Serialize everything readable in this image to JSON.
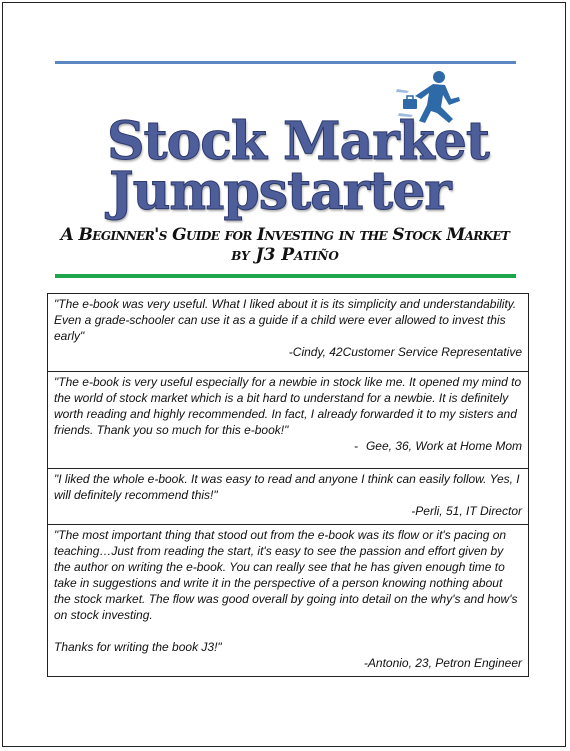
{
  "header": {
    "title_line1": "Stock Market",
    "title_line2": "Jumpstarter",
    "subtitle_line1": "A Beginner's Guide for Investing in the Stock Market",
    "subtitle_line2": "by J3 Patiño",
    "brand_color": "#4d5e9a",
    "rule_top_color": "#5a86c4",
    "rule_bottom_color": "#1fa64a",
    "logo_icon": "running-businessman-icon"
  },
  "testimonials": [
    {
      "quote": "\"The e-book was very useful.  What I liked about it is its simplicity and understandability.  Even a grade-schooler can use it as a guide if a child were ever allowed to invest this early\"",
      "author": "-Cindy, 42Customer Service Representative"
    },
    {
      "quote": "\"The e-book is very useful especially for a newbie in stock like me. It opened my mind to the world of stock market which is a bit hard to understand for a newbie. It is definitely worth reading and highly recommended. In fact, I already forwarded it to my sisters and friends. Thank you so much for this e-book!\"",
      "author_dash": "-",
      "author": "Gee, 36, Work at Home Mom"
    },
    {
      "quote": "\"I liked the whole e-book. It was easy to read and anyone I think can easily follow. Yes, I will definitely recommend this!\"",
      "author": "-Perli, 51, IT Director"
    },
    {
      "quote": "\"The most important thing that stood out from the e-book was its flow or it's pacing on teaching…Just from reading the start, it's easy to see the passion and effort given by the author on writing the e-book. You can really see that he has given enough time to take in suggestions and write it in the perspective of a person knowing nothing about the stock market. The flow was good overall by going into detail on the why's and how's on stock investing.",
      "closing": "Thanks for writing the book J3!\"",
      "author": "-Antonio, 23, Petron Engineer"
    }
  ]
}
